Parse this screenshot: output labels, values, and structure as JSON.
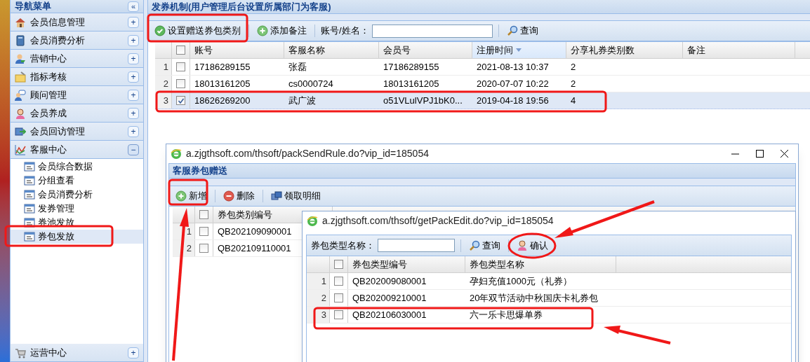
{
  "sidebar": {
    "title": "导航菜单",
    "collapse": "«",
    "groups": [
      {
        "label": "会员信息管理",
        "expanded": false,
        "toggle": "+"
      },
      {
        "label": "会员消费分析",
        "expanded": false,
        "toggle": "+"
      },
      {
        "label": "营销中心",
        "expanded": false,
        "toggle": "+"
      },
      {
        "label": "指标考核",
        "expanded": false,
        "toggle": "+"
      },
      {
        "label": "顾问管理",
        "expanded": false,
        "toggle": "+"
      },
      {
        "label": "会员养成",
        "expanded": false,
        "toggle": "+"
      },
      {
        "label": "会员回访管理",
        "expanded": false,
        "toggle": "+"
      },
      {
        "label": "客服中心",
        "expanded": true,
        "toggle": "−",
        "children": [
          {
            "label": "会员综合数据",
            "selected": false
          },
          {
            "label": "分组查看",
            "selected": false
          },
          {
            "label": "会员消费分析",
            "selected": false
          },
          {
            "label": "发券管理",
            "selected": false
          },
          {
            "label": "券池发放",
            "selected": false
          },
          {
            "label": "券包发放",
            "selected": true
          }
        ]
      },
      {
        "label": "运营中心",
        "expanded": false,
        "toggle": "+"
      }
    ]
  },
  "main": {
    "title": "发券机制(用户管理后台设置所属部门为客服)",
    "toolbar": [
      {
        "kind": "check",
        "label": "设置赠送券包类别"
      },
      {
        "kind": "add",
        "label": "添加备注"
      },
      {
        "kind": "field",
        "label": "账号/姓名："
      },
      {
        "kind": "search",
        "label": "查询"
      }
    ],
    "table": {
      "all_checked": false,
      "columns": [
        {
          "label": "账号",
          "sorted": false
        },
        {
          "label": "客服名称",
          "sorted": false
        },
        {
          "label": "会员号",
          "sorted": false
        },
        {
          "label": "注册时间",
          "sorted": true
        },
        {
          "label": "分享礼券类别数",
          "sorted": false
        },
        {
          "label": "备注",
          "sorted": false
        }
      ],
      "rows": [
        {
          "index": "1",
          "checked": false,
          "selected": false,
          "cells": [
            "17186289155",
            "张磊",
            "17186289155",
            "2021-08-13 10:37",
            "2",
            ""
          ]
        },
        {
          "index": "2",
          "checked": false,
          "selected": false,
          "cells": [
            "18013161205",
            "cs0000724",
            "18013161205",
            "2020-07-07 10:22",
            "2",
            ""
          ]
        },
        {
          "index": "3",
          "checked": true,
          "selected": true,
          "cells": [
            "18626269200",
            "武广波",
            "o51VLulVPJ1bK0...",
            "2019-04-18 19:56",
            "4",
            ""
          ]
        }
      ]
    }
  },
  "popup_send": {
    "url": "a.zjgthsoft.com/thsoft/packSendRule.do?vip_id=185054",
    "title": "客服券包赠送",
    "toolbar": [
      {
        "kind": "add",
        "label": "新增"
      },
      {
        "kind": "delete",
        "label": "删除"
      },
      {
        "kind": "detail",
        "label": "领取明细"
      }
    ],
    "table": {
      "all_checked": false,
      "columns": [
        "券包类别编号"
      ],
      "rows": [
        {
          "index": "1",
          "checked": false,
          "selected": false,
          "cells": [
            "QB202109090001"
          ]
        },
        {
          "index": "2",
          "checked": false,
          "selected": false,
          "cells": [
            "QB202109110001"
          ]
        }
      ]
    }
  },
  "popup_edit": {
    "url": "a.zjgthsoft.com/thsoft/getPackEdit.do?vip_id=185054",
    "toolbar": [
      {
        "kind": "field",
        "label": "券包类型名称："
      },
      {
        "kind": "search",
        "label": "查询"
      },
      {
        "kind": "person",
        "label": "确认"
      }
    ],
    "table": {
      "all_checked": false,
      "columns": [
        "券包类型编号",
        "券包类型名称"
      ],
      "rows": [
        {
          "index": "1",
          "checked": false,
          "selected": false,
          "cells": [
            "QB202009080001",
            "孕妇充值1000元（礼券）"
          ]
        },
        {
          "index": "2",
          "checked": false,
          "selected": false,
          "cells": [
            "QB202009210001",
            "20年双节活动中秋国庆卡礼券包"
          ]
        },
        {
          "index": "3",
          "checked": false,
          "selected": false,
          "cells": [
            "QB202106030001",
            "六一乐卡思爆单券"
          ]
        }
      ]
    }
  }
}
